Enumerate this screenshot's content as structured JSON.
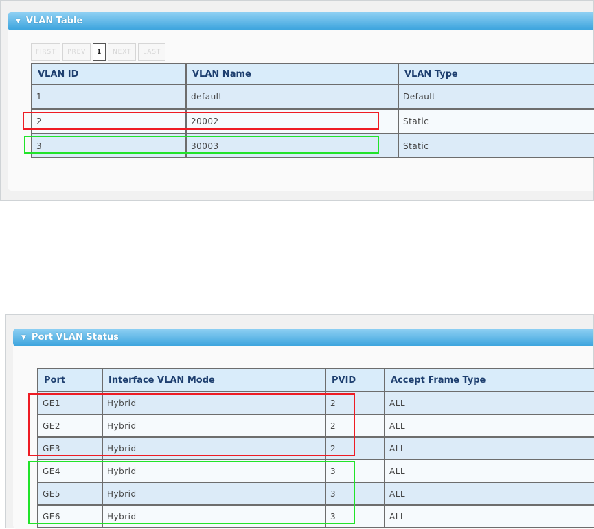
{
  "vlan_panel": {
    "title": "VLAN Table",
    "pager": [
      "FIRST",
      "PREV",
      "1",
      "NEXT",
      "LAST"
    ],
    "columns": [
      "VLAN ID",
      "VLAN Name",
      "VLAN Type"
    ],
    "rows": [
      [
        "1",
        "default",
        "Default"
      ],
      [
        "2",
        "20002",
        "Static"
      ],
      [
        "3",
        "30003",
        "Static"
      ]
    ]
  },
  "port_panel": {
    "title": "Port VLAN Status",
    "columns": [
      "Port",
      "Interface VLAN Mode",
      "PVID",
      "Accept Frame Type"
    ],
    "rows": [
      [
        "GE1",
        "Hybrid",
        "2",
        "ALL"
      ],
      [
        "GE2",
        "Hybrid",
        "2",
        "ALL"
      ],
      [
        "GE3",
        "Hybrid",
        "2",
        "ALL"
      ],
      [
        "GE4",
        "Hybrid",
        "3",
        "ALL"
      ],
      [
        "GE5",
        "Hybrid",
        "3",
        "ALL"
      ],
      [
        "GE6",
        "Hybrid",
        "3",
        "ALL"
      ]
    ]
  },
  "colors": {
    "highlight_red": "#ee1c24",
    "highlight_green": "#22e32a",
    "header_blue": "#3aa3dd"
  }
}
